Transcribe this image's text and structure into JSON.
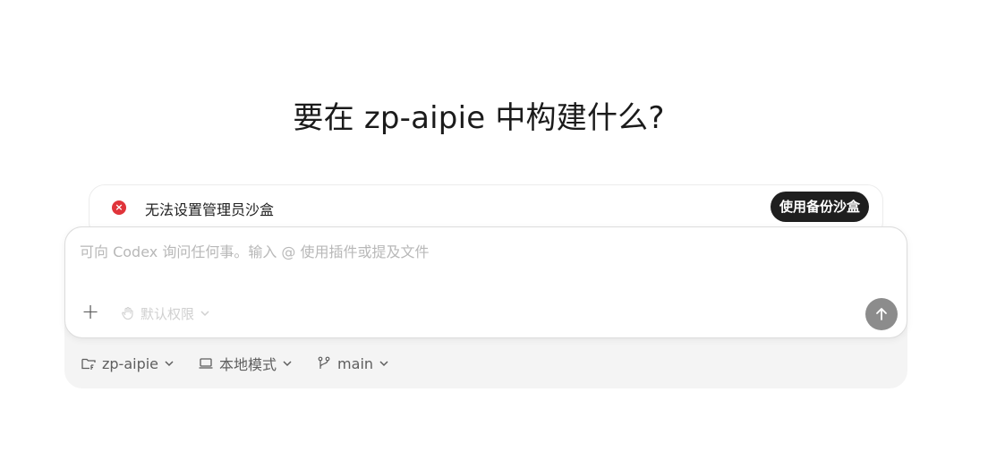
{
  "heading": "要在 zp-aipie 中构建什么?",
  "alert": {
    "message": "无法设置管理员沙盒",
    "action_label": "使用备份沙盒",
    "icon": "error-x-icon"
  },
  "composer": {
    "placeholder": "可向 Codex 询问任何事。输入 @ 使用插件或提及文件",
    "value": "",
    "permission_label": "默认权限",
    "add_icon": "plus-icon",
    "send_icon": "arrow-up-icon"
  },
  "footer": {
    "project_label": "zp-aipie",
    "mode_label": "本地模式",
    "branch_label": "main"
  },
  "colors": {
    "alert_red": "#e0343a",
    "button_dark": "#1f1f1f",
    "send_gray": "#8c8c8c",
    "placeholder_gray": "#b8b8b8"
  }
}
